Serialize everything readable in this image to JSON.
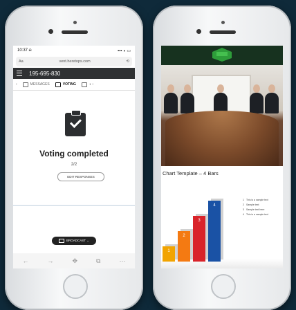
{
  "left_phone": {
    "status": {
      "time": "10:37 ⍾",
      "signal": "▪▪▪ ◗ ▭"
    },
    "url": {
      "prefix": "Aa",
      "domain": "vent.heretops.com",
      "reload": "⟲"
    },
    "topbar": {
      "meeting_id": "195-695-830"
    },
    "tabs": [
      {
        "label": "MESSAGES",
        "icon": "chat-icon"
      },
      {
        "label": "VOTING",
        "icon": "vote-icon"
      },
      {
        "label": "◗ ›",
        "icon": "slides-icon"
      }
    ],
    "voting": {
      "title": "Voting completed",
      "sub": "2/2",
      "edit_label": "EDIT RESPONSES"
    },
    "broadcast_label": "BROADCAST ⌄",
    "nav": [
      "←",
      "→",
      "✥",
      "⧉",
      "⋯"
    ]
  },
  "right_phone": {
    "slide": {
      "title": "Chart Template – 4 Bars",
      "bars": [
        {
          "label": "1",
          "value": 1,
          "color": "#f2a400"
        },
        {
          "label": "2",
          "value": 2,
          "color": "#f47a12"
        },
        {
          "label": "3",
          "value": 3,
          "color": "#d9232a"
        },
        {
          "label": "4",
          "value": 4,
          "color": "#1a52a5"
        }
      ],
      "legend": [
        "This is a sample text",
        "Sample text",
        "Sample text here",
        "This is a sample text"
      ]
    }
  }
}
